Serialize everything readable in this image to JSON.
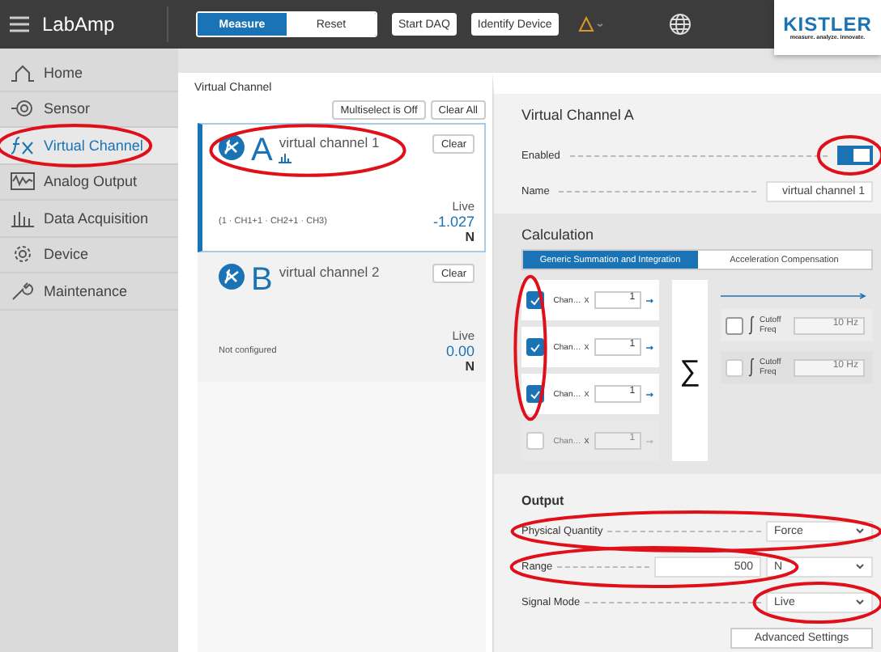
{
  "header": {
    "app_name": "LabAmp",
    "mode_tabs": [
      {
        "label": "Measure",
        "selected": true
      },
      {
        "label": "Reset",
        "selected": false
      }
    ],
    "buttons": [
      "Start DAQ",
      "Identify Device"
    ],
    "logo": {
      "name": "KISTLER",
      "tagline": "measure. analyze. innovate."
    }
  },
  "sidebar": {
    "items": [
      {
        "label": "Home",
        "kind": "home",
        "selected": false
      },
      {
        "label": "Sensor",
        "kind": "sensor",
        "selected": false
      },
      {
        "label": "Virtual Channel",
        "kind": "function",
        "selected": true
      },
      {
        "label": "Analog Output",
        "kind": "wave",
        "selected": false
      },
      {
        "label": "Data Acquisition",
        "kind": "bars",
        "selected": false
      },
      {
        "label": "Device",
        "kind": "gear",
        "selected": false
      },
      {
        "label": "Maintenance",
        "kind": "wrench",
        "selected": false
      }
    ]
  },
  "channels_panel": {
    "title": "Virtual Channel",
    "buttons": [
      "Multiselect is Off",
      "Clear All"
    ],
    "channels": [
      {
        "letter": "A",
        "name": "virtual channel 1",
        "selected": true,
        "configured": true,
        "description": "(1 · CH1+1 · CH2+1 · CH3)",
        "mode": "Live",
        "value": "-1.027",
        "unit": "N",
        "clear": "Clear"
      },
      {
        "letter": "B",
        "name": "virtual channel 2",
        "selected": false,
        "configured": false,
        "description": "Not configured",
        "mode": "Live",
        "value": "0.00",
        "unit": "N",
        "clear": "Clear"
      }
    ]
  },
  "detail": {
    "title": "Virtual Channel A",
    "enabled": {
      "label": "Enabled",
      "on": true
    },
    "name": {
      "label": "Name",
      "value": "virtual channel 1"
    },
    "calculation": {
      "title": "Calculation",
      "tabs": [
        {
          "label": "Generic Summation and Integration",
          "selected": true
        },
        {
          "label": "Acceleration Compensation",
          "selected": false
        }
      ],
      "inputs": [
        {
          "label": "Chan…",
          "multiplier": "x",
          "factor": "1",
          "checked": true,
          "disabled": false
        },
        {
          "label": "Chan…",
          "multiplier": "x",
          "factor": "1",
          "checked": true,
          "disabled": false
        },
        {
          "label": "Chan…",
          "multiplier": "x",
          "factor": "1",
          "checked": true,
          "disabled": false
        },
        {
          "label": "Chan…",
          "multiplier": "x",
          "factor": "1",
          "checked": false,
          "disabled": true
        }
      ],
      "sum_symbol": "∑",
      "filters": [
        {
          "label": "Cutoff",
          "label2": "Freq",
          "value": "10 Hz",
          "checked": false,
          "disabled": false
        },
        {
          "label": "Cutoff",
          "label2": "Freq",
          "value": "10 Hz",
          "checked": false,
          "disabled": true
        }
      ]
    },
    "output": {
      "title": "Output",
      "fields": [
        {
          "label": "Physical Quantity",
          "kind": "select",
          "value": "Force"
        },
        {
          "label": "Range",
          "kind": "range",
          "value": "500",
          "unit": "N"
        },
        {
          "label": "Signal Mode",
          "kind": "select",
          "value": "Live"
        }
      ],
      "advanced": "Advanced Settings"
    }
  }
}
